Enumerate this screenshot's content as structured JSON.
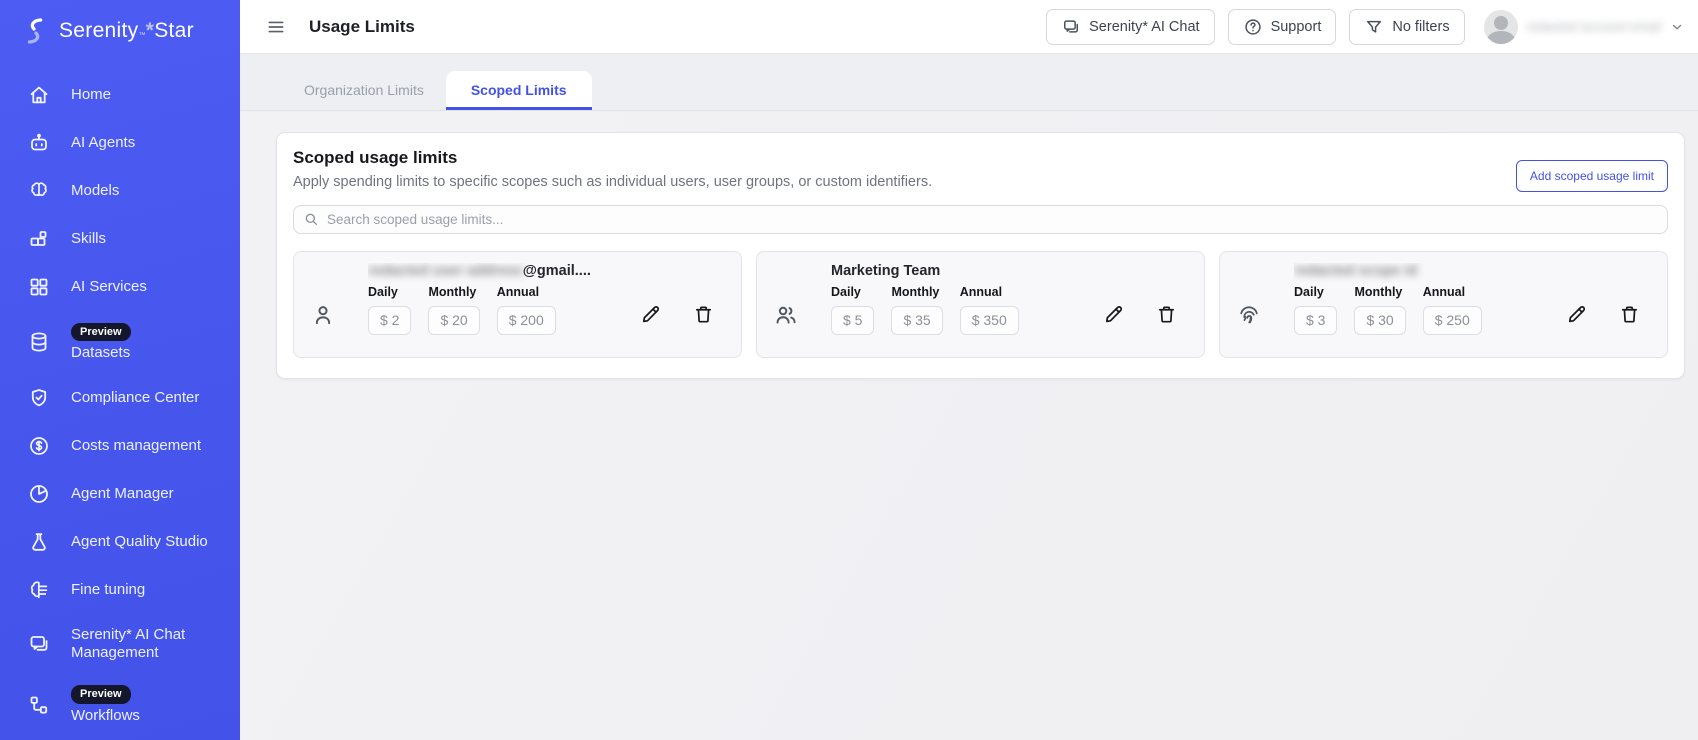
{
  "colors": {
    "accent": "#4352e4",
    "sidebar_bg": "#4a57ef",
    "badge_bg": "#14162b",
    "tab_active_text": "#4352e4"
  },
  "brand": {
    "name": "Serenity",
    "trademark": "™",
    "star": "*",
    "suffix": "Star"
  },
  "sidebar": {
    "items": [
      {
        "label": "Home",
        "icon": "home-icon"
      },
      {
        "label": "AI Agents",
        "icon": "robot-icon"
      },
      {
        "label": "Models",
        "icon": "brain-icon"
      },
      {
        "label": "Skills",
        "icon": "skills-icon"
      },
      {
        "label": "AI Services",
        "icon": "grid-icon"
      },
      {
        "label": "Datasets",
        "icon": "database-icon",
        "badge": "Preview"
      },
      {
        "label": "Compliance Center",
        "icon": "shield-check-icon"
      },
      {
        "label": "Costs management",
        "icon": "dollar-circle-icon"
      },
      {
        "label": "Agent Manager",
        "icon": "pie-chart-icon"
      },
      {
        "label": "Agent Quality Studio",
        "icon": "flask-icon"
      },
      {
        "label": "Fine tuning",
        "icon": "fine-tune-icon"
      },
      {
        "label": "Serenity* AI Chat Management",
        "icon": "chat-icon"
      },
      {
        "label": "Workflows",
        "icon": "workflow-icon",
        "badge": "Preview"
      }
    ]
  },
  "header": {
    "title": "Usage Limits",
    "buttons": [
      {
        "label": "Serenity* AI Chat",
        "icon": "chat-icon"
      },
      {
        "label": "Support",
        "icon": "help-circle-icon"
      },
      {
        "label": "No filters",
        "icon": "funnel-icon"
      }
    ],
    "user": {
      "redacted": true,
      "redacted_text": "redacted account email"
    }
  },
  "tabs": [
    {
      "label": "Organization Limits",
      "active": false
    },
    {
      "label": "Scoped Limits",
      "active": true
    }
  ],
  "panel": {
    "title": "Scoped usage limits",
    "description": "Apply spending limits to specific scopes such as individual users, user groups, or custom identifiers.",
    "add_button": "Add scoped usage limit",
    "search_placeholder": "Search scoped usage limits...",
    "field_labels": {
      "daily": "Daily",
      "monthly": "Monthly",
      "annual": "Annual"
    },
    "cards": [
      {
        "icon": "user-icon",
        "redacted": true,
        "title_redacted": "redacted user address",
        "title_suffix": "@gmail....",
        "values": {
          "daily": "$ 2",
          "monthly": "$ 20",
          "annual": "$ 200"
        }
      },
      {
        "icon": "users-icon",
        "redacted": false,
        "title": "Marketing Team",
        "values": {
          "daily": "$ 5",
          "monthly": "$ 35",
          "annual": "$ 350"
        }
      },
      {
        "icon": "fingerprint-icon",
        "redacted": true,
        "title_redacted": "redacted scope id",
        "values": {
          "daily": "$ 3",
          "monthly": "$ 30",
          "annual": "$ 250"
        }
      }
    ]
  }
}
